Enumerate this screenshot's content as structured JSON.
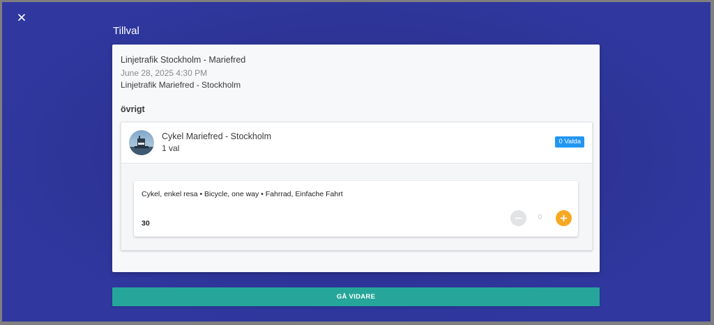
{
  "header": {
    "close_icon": "close-icon",
    "title": "Tillval"
  },
  "trip": {
    "route_1": "Linjetrafik Stockholm - Mariefred",
    "datetime": "June 28, 2025 4:30 PM",
    "route_2": "Linjetrafik Mariefred - Stockholm"
  },
  "section": {
    "title": "övrigt"
  },
  "product": {
    "avatar_icon": "boat-photo-avatar",
    "name": "Cykel Mariefred - Stockholm",
    "subtitle": "1 val",
    "badge": "0 Valda"
  },
  "option": {
    "name": "Cykel, enkel resa • Bicycle, one way • Fahrrad, Einfache Fahrt",
    "price": "30",
    "quantity": "0",
    "minus_icon": "minus-icon",
    "plus_icon": "plus-icon"
  },
  "footer": {
    "continue_label": "GÅ VIDARE"
  },
  "colors": {
    "background": "#2d3394",
    "badge": "#2196f3",
    "plus_button": "#f7a823",
    "continue_button": "#26a69a"
  }
}
